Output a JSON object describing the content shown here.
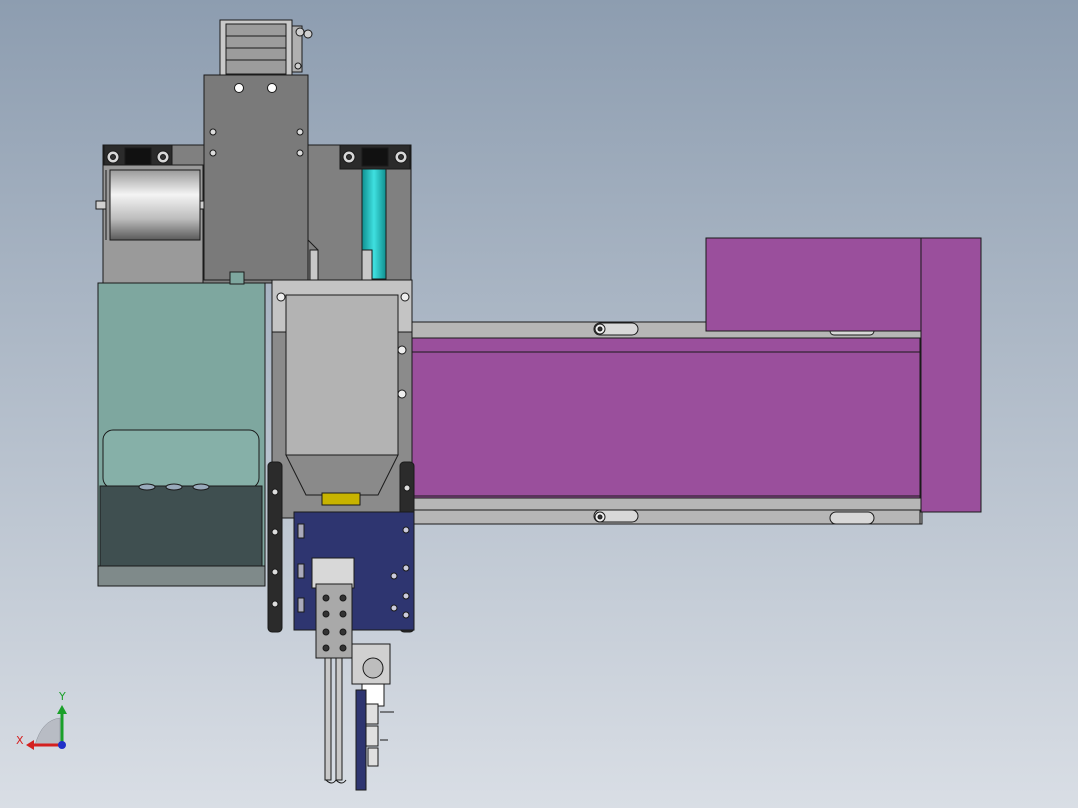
{
  "viewport": {
    "background_top": "#8d9db0",
    "background_bottom": "#d9dee5"
  },
  "model": {
    "colors": {
      "frame_gray": "#7f7f7f",
      "light_gray": "#bdbdbd",
      "outline": "#1a1a1a",
      "teal_housing": "#7ea79f",
      "teal_dark": "#3f4f50",
      "cyan_rod": "#19c3c3",
      "magenta_motor": "#9a4f9c",
      "navy_plate": "#2e3570",
      "yellow_block": "#c8b400",
      "roller_silver": "#e6e6e6"
    }
  },
  "triad": {
    "x_label": "X",
    "y_label": "Y",
    "x_color": "#d42020",
    "y_color": "#1aa02a",
    "z_color": "#2030c8"
  }
}
